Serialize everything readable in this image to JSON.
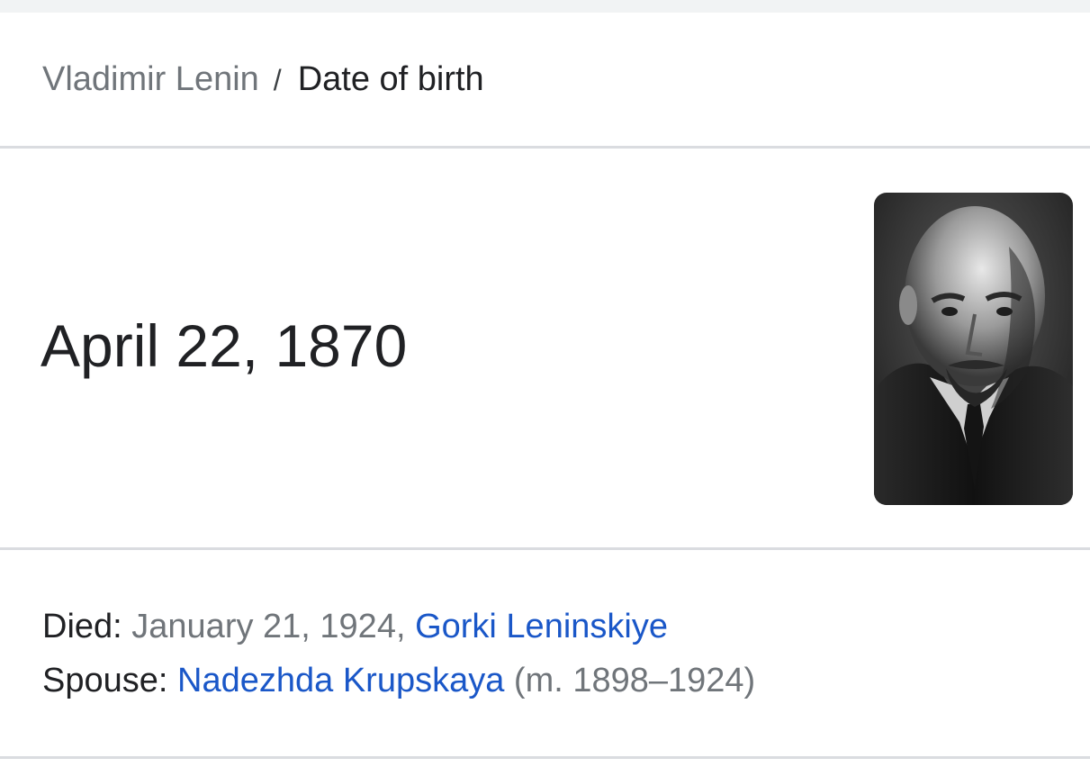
{
  "breadcrumb": {
    "parent": "Vladimir Lenin",
    "separator": "/",
    "current": "Date of birth"
  },
  "answer": {
    "value": "April 22, 1870"
  },
  "portrait": {
    "icon": "person-portrait-photo"
  },
  "facts": {
    "died": {
      "label": "Died:",
      "date": "January 21, 1924,",
      "place_link": "Gorki Leninskiye"
    },
    "spouse": {
      "label": "Spouse:",
      "name_link": "Nadezhda Krupskaya",
      "detail": "(m. 1898–1924)"
    }
  },
  "colors": {
    "link": "#1a57c8",
    "secondary_text": "#70757a",
    "primary_text": "#202124",
    "divider": "#dadce0"
  }
}
